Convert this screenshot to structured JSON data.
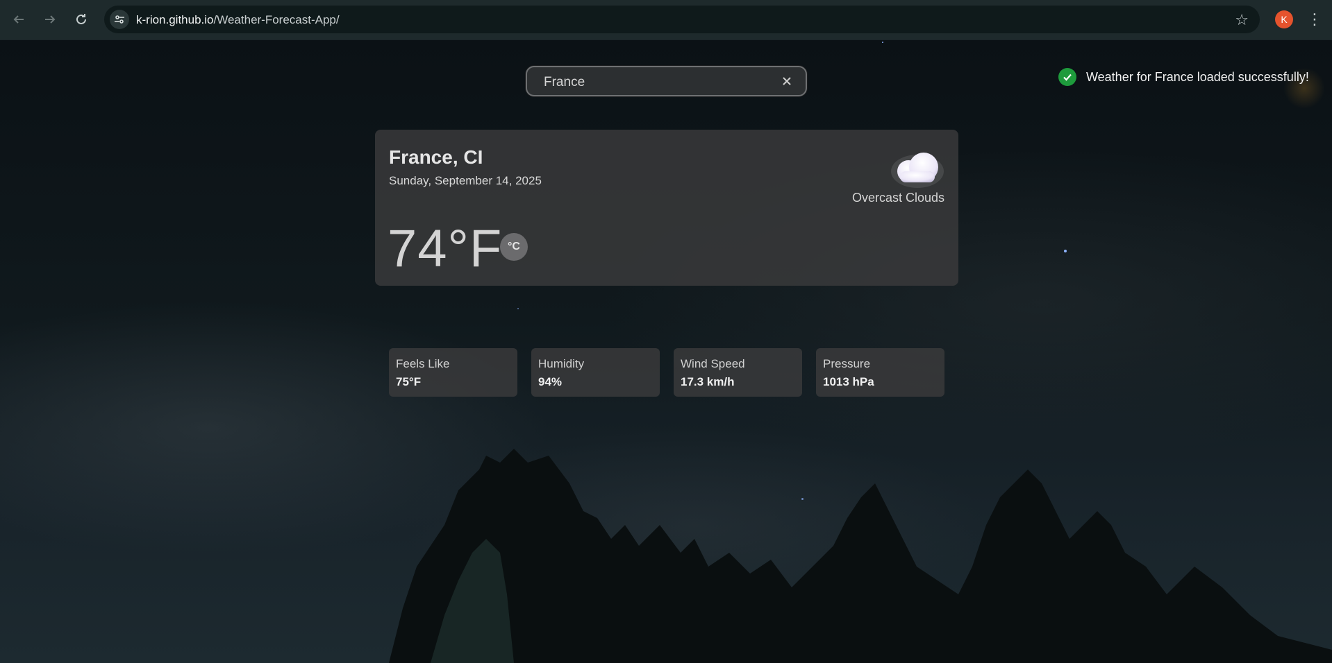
{
  "browser": {
    "url_host": "k-rion.github.io",
    "url_path": "/Weather-Forecast-App/",
    "profile_initial": "K"
  },
  "search": {
    "value": "France"
  },
  "toast": {
    "message": "Weather for France loaded successfully!"
  },
  "current": {
    "city": "France, CI",
    "date": "Sunday, September 14, 2025",
    "temperature": "74°F",
    "unit_toggle": "°C",
    "condition": "Overcast Clouds",
    "icon": "cloud-icon"
  },
  "stats": [
    {
      "label": "Feels Like",
      "value": "75°F"
    },
    {
      "label": "Humidity",
      "value": "94%"
    },
    {
      "label": "Wind Speed",
      "value": "17.3 km/h"
    },
    {
      "label": "Pressure",
      "value": "1013 hPa"
    }
  ],
  "colors": {
    "toast_check": "#1e9b3c",
    "profile": "#e5532d",
    "card_bg": "#3a3a3c"
  }
}
